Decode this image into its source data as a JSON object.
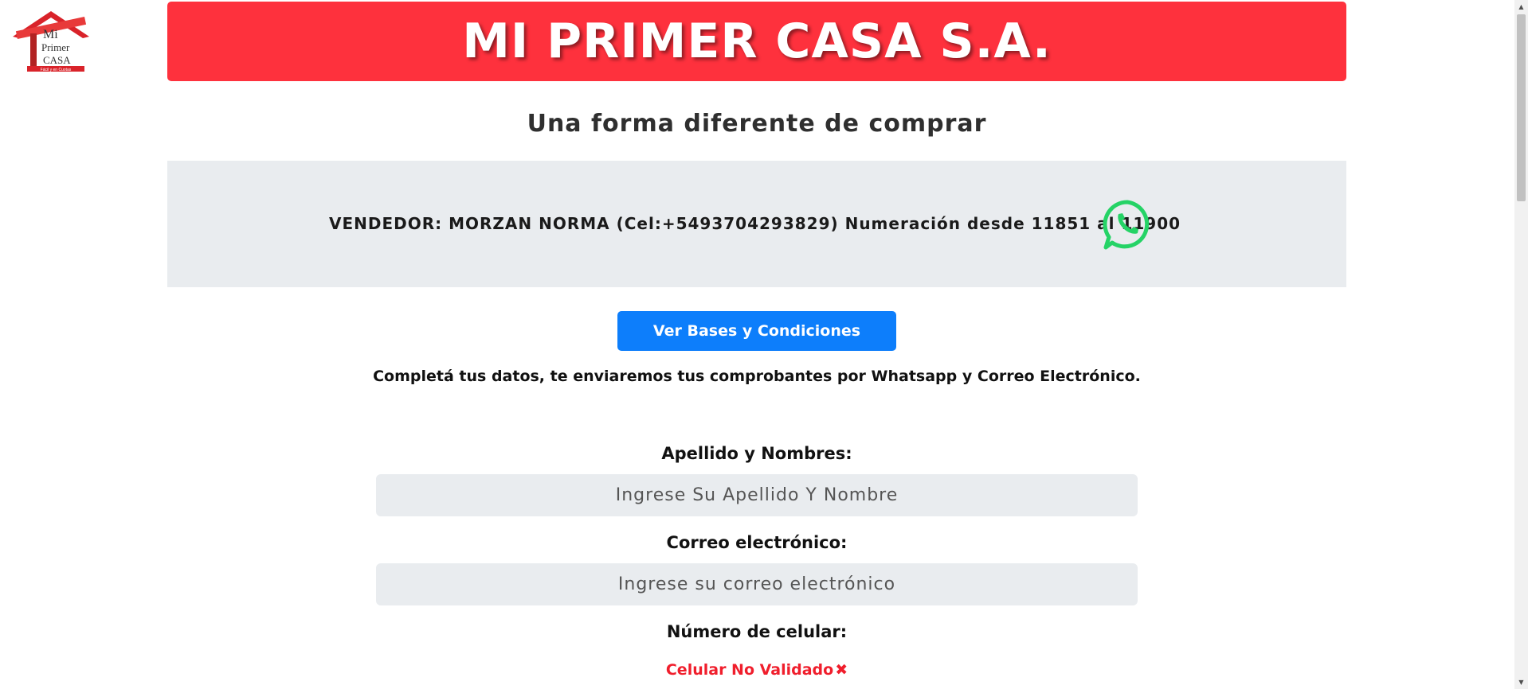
{
  "header": {
    "title": "MI PRIMER CASA S.A.",
    "subtitle": "Una forma diferente de comprar"
  },
  "logo": {
    "line1": "Mi",
    "line2": "Primer",
    "line3": "CASA",
    "tagline": "Fácil y en Cuotas"
  },
  "seller": {
    "text": "VENDEDOR: MORZAN NORMA (Cel:+5493704293829) Numeración desde 11851 al 11900",
    "icon": "whatsapp-icon"
  },
  "terms_button": {
    "label": "Ver Bases y Condiciones"
  },
  "info": {
    "text": "Completá tus datos, te enviaremos tus comprobantes por Whatsapp y Correo Electrónico."
  },
  "form": {
    "name_label": "Apellido y Nombres:",
    "name_placeholder": "Ingrese Su Apellido Y Nombre",
    "email_label": "Correo electrónico:",
    "email_placeholder": "Ingrese su correo electrónico",
    "phone_label": "Número de celular:",
    "phone_status": "Celular No Validado"
  },
  "colors": {
    "banner": "#fe313d",
    "button": "#0d7efb",
    "panel": "#e9ecef",
    "whatsapp": "#25d366",
    "error": "#f01e2c"
  }
}
